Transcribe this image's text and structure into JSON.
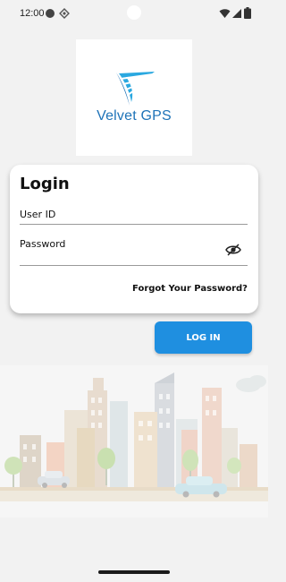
{
  "status_bar": {
    "time": "12:00",
    "icons": [
      "circle-status-icon",
      "diamond-status-icon",
      "wifi-icon",
      "signal-icon",
      "battery-icon"
    ]
  },
  "logo": {
    "brand_name": "Velvet GPS",
    "colors": {
      "primary": "#1e73b8",
      "secondary": "#2aa8e0"
    }
  },
  "login_card": {
    "title": "Login",
    "user_id": {
      "label": "User ID",
      "value": ""
    },
    "password": {
      "label": "Password",
      "value": "",
      "visibility_icon": "eye-off-icon"
    },
    "forgot_password_label": "Forgot Your Password?"
  },
  "login_button": {
    "label": "LOG IN",
    "color": "#1f8fe0"
  },
  "colors": {
    "background": "#f2f2f2",
    "card": "#ffffff"
  }
}
